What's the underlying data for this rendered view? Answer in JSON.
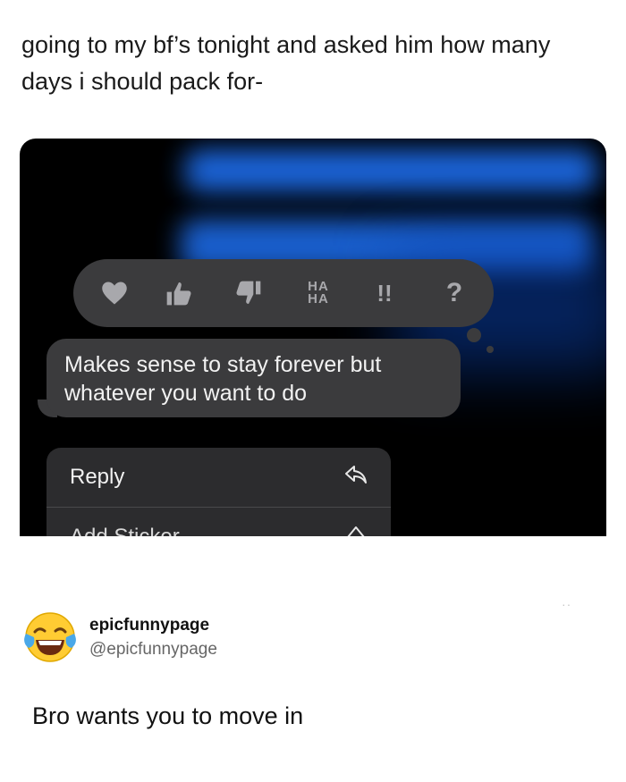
{
  "caption": "going to my bf’s tonight and asked him how many days i should pack for-",
  "screenshot": {
    "tapbacks": {
      "heart": "heart-icon",
      "thumbs_up": "thumbs-up-icon",
      "thumbs_down": "thumbs-down-icon",
      "haha_top": "HA",
      "haha_bottom": "HA",
      "emphasize": "!!",
      "question": "?"
    },
    "message": {
      "line1": "Makes sense to stay forever  but",
      "line2": "whatever you want to do"
    },
    "menu": {
      "reply_label": "Reply",
      "add_sticker_label": "Add Sticker"
    },
    "colors": {
      "bubble": "#3b3b3d",
      "menu": "#2c2c2e",
      "blur_accent": "#1e6ff0"
    }
  },
  "tweet": {
    "avatar": "face-with-tears-of-joy-emoji",
    "name": "epicfunnypage",
    "handle": "@epicfunnypage",
    "more": "··",
    "text": "Bro wants you to move in"
  }
}
